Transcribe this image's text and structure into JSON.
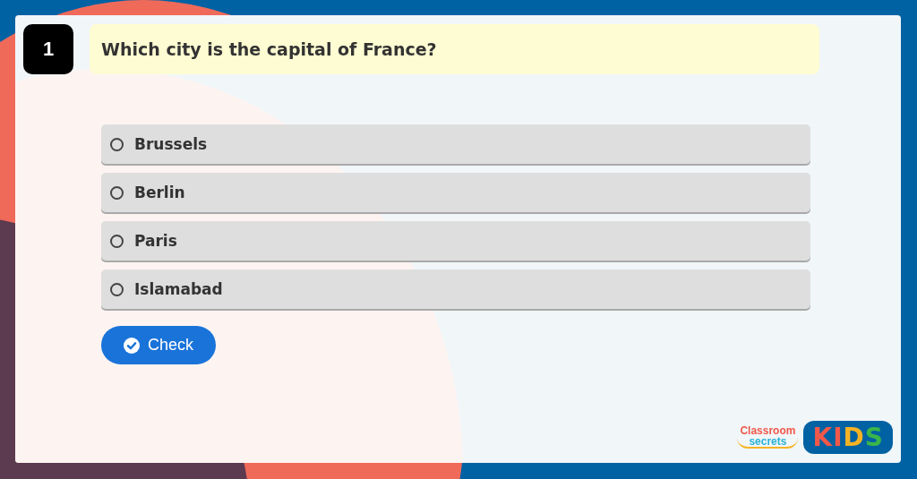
{
  "question": {
    "number": "1",
    "text": "Which city is the capital of France?"
  },
  "options": [
    {
      "label": "Brussels",
      "selected": false
    },
    {
      "label": "Berlin",
      "selected": false
    },
    {
      "label": "Paris",
      "selected": false
    },
    {
      "label": "Islamabad",
      "selected": false
    }
  ],
  "check_button": {
    "label": "Check"
  },
  "logo": {
    "brand_top": "Classroom",
    "brand_bottom": "secrets",
    "badge": "KIDS"
  }
}
